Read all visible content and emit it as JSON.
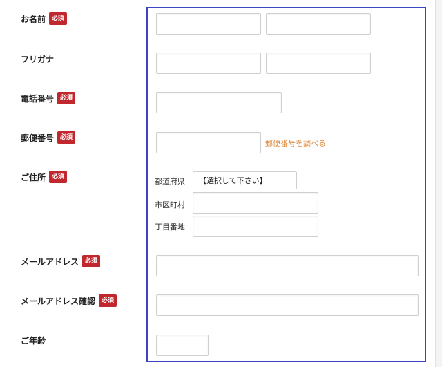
{
  "form": {
    "required_badge": "必須",
    "name": {
      "label": "お名前"
    },
    "furigana": {
      "label": "フリガナ"
    },
    "phone": {
      "label": "電話番号"
    },
    "postal": {
      "label": "郵便番号",
      "lookup_link": "郵便番号を調べる"
    },
    "address": {
      "label": "ご住所",
      "prefecture_label": "都道府県",
      "prefecture_value": "【選択して下さい】",
      "city_label": "市区町村",
      "street_label": "丁目番地"
    },
    "email": {
      "label": "メールアドレス"
    },
    "email_confirm": {
      "label": "メールアドレス確認"
    },
    "age": {
      "label": "ご年齢"
    }
  },
  "colors": {
    "required_badge": "#c0282d",
    "highlight_border": "#3b45c4",
    "link": "#e08a3c"
  }
}
